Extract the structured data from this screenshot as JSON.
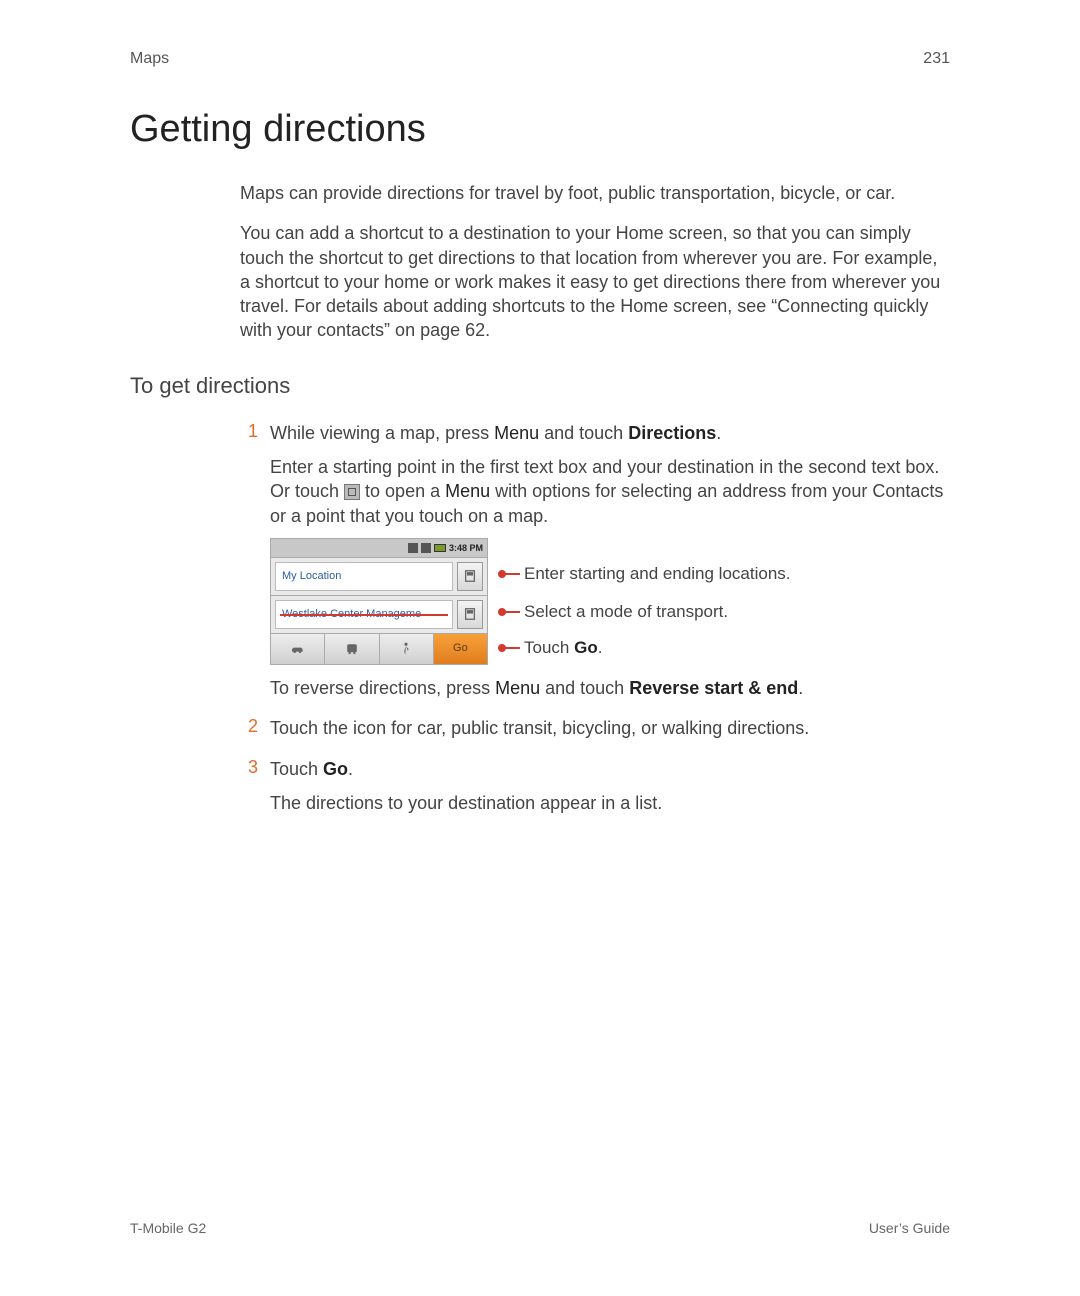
{
  "header": {
    "section": "Maps",
    "page_number": "231"
  },
  "title": "Getting directions",
  "intro_paragraphs": [
    "Maps can provide directions for travel by foot, public transportation, bicycle, or car.",
    "You can add a shortcut to a destination to your Home screen, so that you can simply touch the shortcut to get directions to that location from wherever you are. For example, a shortcut to your home or work makes it easy to get directions there from wherever you travel. For details about adding shortcuts to the Home screen, see “Connecting quickly with your contacts” on page 62."
  ],
  "subhead": "To get directions",
  "steps": {
    "s1": {
      "num": "1",
      "line_pre": "While viewing a map, press ",
      "menu": "Menu",
      "line_mid": " and touch ",
      "bold": "Directions",
      "line_post": ".",
      "detail_pre": "Enter a starting point in the first text box and your destination in the second text box. Or touch ",
      "detail_mid": " to open a ",
      "detail_menu": "Menu",
      "detail_post": " with options for selecting an address from your Contacts or a point that you touch on a map.",
      "reverse_pre": "To reverse directions, press ",
      "reverse_menu": "Menu",
      "reverse_mid": " and touch ",
      "reverse_bold": "Reverse start & end",
      "reverse_post": "."
    },
    "s2": {
      "num": "2",
      "text": "Touch the icon for car, public transit, bicycling, or walking directions."
    },
    "s3": {
      "num": "3",
      "pre": "Touch ",
      "bold": "Go",
      "post": ".",
      "result": "The directions to your destination appear in a list."
    }
  },
  "phone": {
    "time": "3:48 PM",
    "field_start": "My Location",
    "field_end": "Westlake Center Manageme",
    "go_label": "Go"
  },
  "callouts": {
    "c1": "Enter starting and ending locations.",
    "c2": "Select a mode of transport.",
    "c3_pre": "Touch ",
    "c3_bold": "Go",
    "c3_post": "."
  },
  "footer": {
    "left": "T-Mobile G2",
    "right": "User’s Guide"
  }
}
